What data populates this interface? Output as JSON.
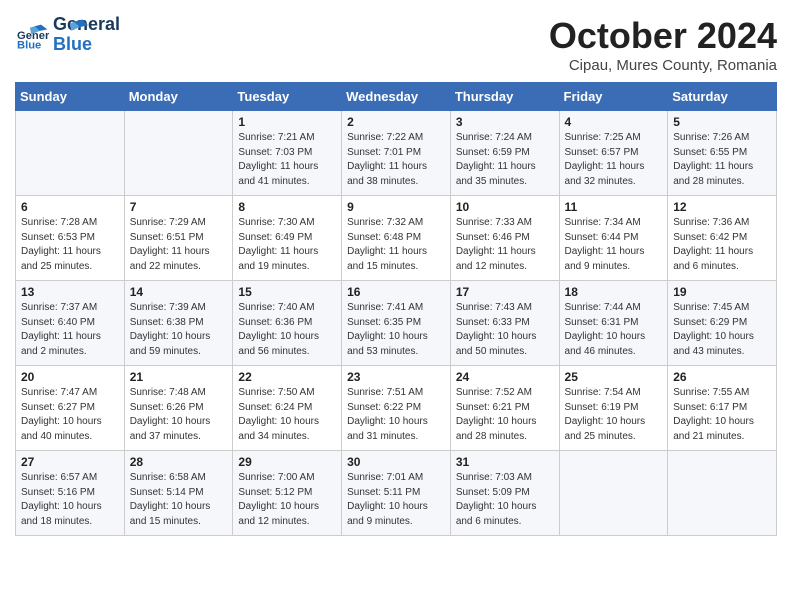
{
  "header": {
    "logo_general": "General",
    "logo_blue": "Blue",
    "month_title": "October 2024",
    "subtitle": "Cipau, Mures County, Romania"
  },
  "days_of_week": [
    "Sunday",
    "Monday",
    "Tuesday",
    "Wednesday",
    "Thursday",
    "Friday",
    "Saturday"
  ],
  "weeks": [
    [
      {
        "day": "",
        "sunrise": "",
        "sunset": "",
        "daylight": ""
      },
      {
        "day": "",
        "sunrise": "",
        "sunset": "",
        "daylight": ""
      },
      {
        "day": "1",
        "sunrise": "Sunrise: 7:21 AM",
        "sunset": "Sunset: 7:03 PM",
        "daylight": "Daylight: 11 hours and 41 minutes."
      },
      {
        "day": "2",
        "sunrise": "Sunrise: 7:22 AM",
        "sunset": "Sunset: 7:01 PM",
        "daylight": "Daylight: 11 hours and 38 minutes."
      },
      {
        "day": "3",
        "sunrise": "Sunrise: 7:24 AM",
        "sunset": "Sunset: 6:59 PM",
        "daylight": "Daylight: 11 hours and 35 minutes."
      },
      {
        "day": "4",
        "sunrise": "Sunrise: 7:25 AM",
        "sunset": "Sunset: 6:57 PM",
        "daylight": "Daylight: 11 hours and 32 minutes."
      },
      {
        "day": "5",
        "sunrise": "Sunrise: 7:26 AM",
        "sunset": "Sunset: 6:55 PM",
        "daylight": "Daylight: 11 hours and 28 minutes."
      }
    ],
    [
      {
        "day": "6",
        "sunrise": "Sunrise: 7:28 AM",
        "sunset": "Sunset: 6:53 PM",
        "daylight": "Daylight: 11 hours and 25 minutes."
      },
      {
        "day": "7",
        "sunrise": "Sunrise: 7:29 AM",
        "sunset": "Sunset: 6:51 PM",
        "daylight": "Daylight: 11 hours and 22 minutes."
      },
      {
        "day": "8",
        "sunrise": "Sunrise: 7:30 AM",
        "sunset": "Sunset: 6:49 PM",
        "daylight": "Daylight: 11 hours and 19 minutes."
      },
      {
        "day": "9",
        "sunrise": "Sunrise: 7:32 AM",
        "sunset": "Sunset: 6:48 PM",
        "daylight": "Daylight: 11 hours and 15 minutes."
      },
      {
        "day": "10",
        "sunrise": "Sunrise: 7:33 AM",
        "sunset": "Sunset: 6:46 PM",
        "daylight": "Daylight: 11 hours and 12 minutes."
      },
      {
        "day": "11",
        "sunrise": "Sunrise: 7:34 AM",
        "sunset": "Sunset: 6:44 PM",
        "daylight": "Daylight: 11 hours and 9 minutes."
      },
      {
        "day": "12",
        "sunrise": "Sunrise: 7:36 AM",
        "sunset": "Sunset: 6:42 PM",
        "daylight": "Daylight: 11 hours and 6 minutes."
      }
    ],
    [
      {
        "day": "13",
        "sunrise": "Sunrise: 7:37 AM",
        "sunset": "Sunset: 6:40 PM",
        "daylight": "Daylight: 11 hours and 2 minutes."
      },
      {
        "day": "14",
        "sunrise": "Sunrise: 7:39 AM",
        "sunset": "Sunset: 6:38 PM",
        "daylight": "Daylight: 10 hours and 59 minutes."
      },
      {
        "day": "15",
        "sunrise": "Sunrise: 7:40 AM",
        "sunset": "Sunset: 6:36 PM",
        "daylight": "Daylight: 10 hours and 56 minutes."
      },
      {
        "day": "16",
        "sunrise": "Sunrise: 7:41 AM",
        "sunset": "Sunset: 6:35 PM",
        "daylight": "Daylight: 10 hours and 53 minutes."
      },
      {
        "day": "17",
        "sunrise": "Sunrise: 7:43 AM",
        "sunset": "Sunset: 6:33 PM",
        "daylight": "Daylight: 10 hours and 50 minutes."
      },
      {
        "day": "18",
        "sunrise": "Sunrise: 7:44 AM",
        "sunset": "Sunset: 6:31 PM",
        "daylight": "Daylight: 10 hours and 46 minutes."
      },
      {
        "day": "19",
        "sunrise": "Sunrise: 7:45 AM",
        "sunset": "Sunset: 6:29 PM",
        "daylight": "Daylight: 10 hours and 43 minutes."
      }
    ],
    [
      {
        "day": "20",
        "sunrise": "Sunrise: 7:47 AM",
        "sunset": "Sunset: 6:27 PM",
        "daylight": "Daylight: 10 hours and 40 minutes."
      },
      {
        "day": "21",
        "sunrise": "Sunrise: 7:48 AM",
        "sunset": "Sunset: 6:26 PM",
        "daylight": "Daylight: 10 hours and 37 minutes."
      },
      {
        "day": "22",
        "sunrise": "Sunrise: 7:50 AM",
        "sunset": "Sunset: 6:24 PM",
        "daylight": "Daylight: 10 hours and 34 minutes."
      },
      {
        "day": "23",
        "sunrise": "Sunrise: 7:51 AM",
        "sunset": "Sunset: 6:22 PM",
        "daylight": "Daylight: 10 hours and 31 minutes."
      },
      {
        "day": "24",
        "sunrise": "Sunrise: 7:52 AM",
        "sunset": "Sunset: 6:21 PM",
        "daylight": "Daylight: 10 hours and 28 minutes."
      },
      {
        "day": "25",
        "sunrise": "Sunrise: 7:54 AM",
        "sunset": "Sunset: 6:19 PM",
        "daylight": "Daylight: 10 hours and 25 minutes."
      },
      {
        "day": "26",
        "sunrise": "Sunrise: 7:55 AM",
        "sunset": "Sunset: 6:17 PM",
        "daylight": "Daylight: 10 hours and 21 minutes."
      }
    ],
    [
      {
        "day": "27",
        "sunrise": "Sunrise: 6:57 AM",
        "sunset": "Sunset: 5:16 PM",
        "daylight": "Daylight: 10 hours and 18 minutes."
      },
      {
        "day": "28",
        "sunrise": "Sunrise: 6:58 AM",
        "sunset": "Sunset: 5:14 PM",
        "daylight": "Daylight: 10 hours and 15 minutes."
      },
      {
        "day": "29",
        "sunrise": "Sunrise: 7:00 AM",
        "sunset": "Sunset: 5:12 PM",
        "daylight": "Daylight: 10 hours and 12 minutes."
      },
      {
        "day": "30",
        "sunrise": "Sunrise: 7:01 AM",
        "sunset": "Sunset: 5:11 PM",
        "daylight": "Daylight: 10 hours and 9 minutes."
      },
      {
        "day": "31",
        "sunrise": "Sunrise: 7:03 AM",
        "sunset": "Sunset: 5:09 PM",
        "daylight": "Daylight: 10 hours and 6 minutes."
      },
      {
        "day": "",
        "sunrise": "",
        "sunset": "",
        "daylight": ""
      },
      {
        "day": "",
        "sunrise": "",
        "sunset": "",
        "daylight": ""
      }
    ]
  ]
}
